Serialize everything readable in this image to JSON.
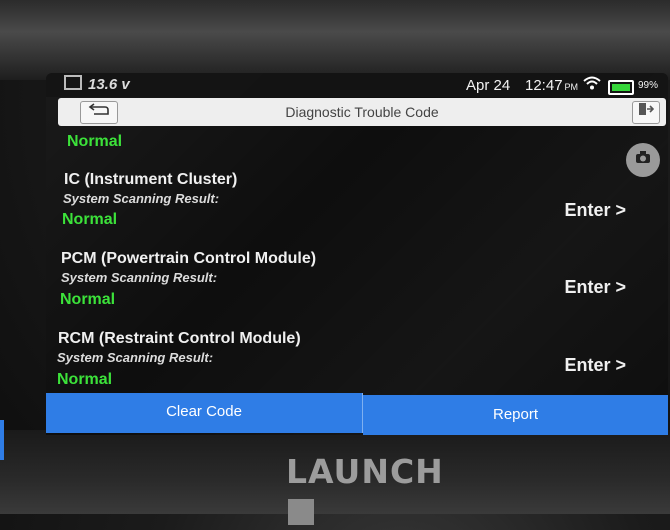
{
  "status_bar": {
    "voltage": "13.6 v",
    "date": "Apr 24",
    "time": "12:47",
    "ampm": "PM",
    "battery_pct": "99%",
    "battery_level": 0.99,
    "wifi_icon": "wifi-icon"
  },
  "header": {
    "title": "Diagnostic Trouble Code",
    "back_icon": "back-arrow-icon",
    "exit_icon": "exit-icon",
    "camera_icon": "camera-icon"
  },
  "top_status": "Normal",
  "modules": [
    {
      "name": "IC (Instrument Cluster)",
      "subtitle": "System Scanning Result:",
      "status": "Normal",
      "enter_label": "Enter >"
    },
    {
      "name": "PCM (Powertrain Control Module)",
      "subtitle": "System Scanning Result:",
      "status": "Normal",
      "enter_label": "Enter >"
    },
    {
      "name": "RCM (Restraint Control Module)",
      "subtitle": "System Scanning Result:",
      "status": "Normal",
      "enter_label": "Enter >"
    }
  ],
  "footer": {
    "clear_code_label": "Clear Code",
    "report_label": "Report"
  },
  "device": {
    "brand": "LAUNCH"
  },
  "colors": {
    "accent_blue": "#2f7de6",
    "status_green": "#3ce23a",
    "title_bar_bg": "#eeeeee"
  }
}
